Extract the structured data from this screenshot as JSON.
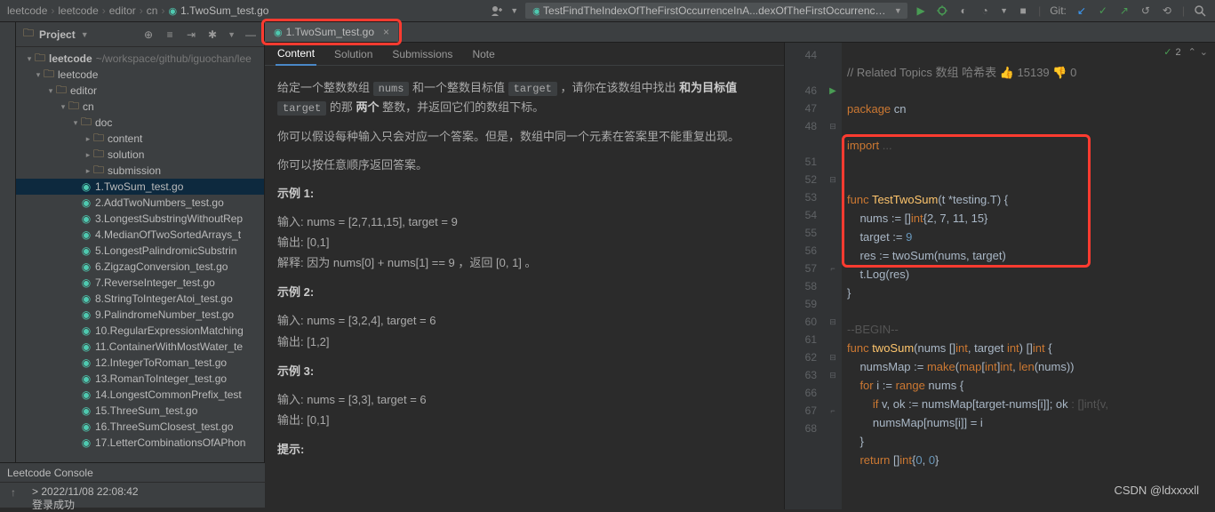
{
  "breadcrumbs": [
    "leetcode",
    "leetcode",
    "editor",
    "cn"
  ],
  "breadcrumb_file": "1.TwoSum_test.go",
  "open_tab": "TestFindTheIndexOfTheFirstOccurrenceInA...dexOfTheFirstOccurrenceInAString_test.go",
  "git_label": "Git:",
  "project": {
    "title": "Project",
    "root": {
      "name": "leetcode",
      "path": "~/workspace/github/iguochan/lee"
    },
    "tree": [
      {
        "indent": 1,
        "kind": "folder",
        "name": "leetcode",
        "chev": "v"
      },
      {
        "indent": 2,
        "kind": "folder",
        "name": "editor",
        "chev": "v"
      },
      {
        "indent": 3,
        "kind": "folder",
        "name": "cn",
        "chev": "v"
      },
      {
        "indent": 4,
        "kind": "folder",
        "name": "doc",
        "chev": "v"
      },
      {
        "indent": 5,
        "kind": "folder",
        "name": "content",
        "chev": ">"
      },
      {
        "indent": 5,
        "kind": "folder",
        "name": "solution",
        "chev": ">"
      },
      {
        "indent": 5,
        "kind": "folder",
        "name": "submission",
        "chev": ">"
      },
      {
        "indent": 4,
        "kind": "go",
        "name": "1.TwoSum_test.go",
        "sel": true
      },
      {
        "indent": 4,
        "kind": "go",
        "name": "2.AddTwoNumbers_test.go"
      },
      {
        "indent": 4,
        "kind": "go",
        "name": "3.LongestSubstringWithoutRep"
      },
      {
        "indent": 4,
        "kind": "go",
        "name": "4.MedianOfTwoSortedArrays_t"
      },
      {
        "indent": 4,
        "kind": "go",
        "name": "5.LongestPalindromicSubstrin"
      },
      {
        "indent": 4,
        "kind": "go",
        "name": "6.ZigzagConversion_test.go"
      },
      {
        "indent": 4,
        "kind": "go",
        "name": "7.ReverseInteger_test.go"
      },
      {
        "indent": 4,
        "kind": "go",
        "name": "8.StringToIntegerAtoi_test.go"
      },
      {
        "indent": 4,
        "kind": "go",
        "name": "9.PalindromeNumber_test.go"
      },
      {
        "indent": 4,
        "kind": "go",
        "name": "10.RegularExpressionMatching"
      },
      {
        "indent": 4,
        "kind": "go",
        "name": "11.ContainerWithMostWater_te"
      },
      {
        "indent": 4,
        "kind": "go",
        "name": "12.IntegerToRoman_test.go"
      },
      {
        "indent": 4,
        "kind": "go",
        "name": "13.RomanToInteger_test.go"
      },
      {
        "indent": 4,
        "kind": "go",
        "name": "14.LongestCommonPrefix_test"
      },
      {
        "indent": 4,
        "kind": "go",
        "name": "15.ThreeSum_test.go"
      },
      {
        "indent": 4,
        "kind": "go",
        "name": "16.ThreeSumClosest_test.go"
      },
      {
        "indent": 4,
        "kind": "go",
        "name": "17.LetterCombinationsOfAPhon"
      }
    ]
  },
  "editor_tab": "1.TwoSum_test.go",
  "content_tabs": [
    "Content",
    "Solution",
    "Submissions",
    "Note"
  ],
  "content": {
    "p1_a": "给定一个整数数组 ",
    "p1_nums": "nums",
    "p1_b": " 和一个整数目标值 ",
    "p1_target": "target",
    "p1_c": " ，请你在该数组中找出 ",
    "p1_bold": "和为目标值",
    "p2_target": "target",
    "p2_a": " 的那 ",
    "p2_bold": "两个",
    "p2_b": " 整数，并返回它们的数组下标。",
    "p3": "你可以假设每种输入只会对应一个答案。但是，数组中同一个元素在答案里不能重复出现。",
    "p4": "你可以按任意顺序返回答案。",
    "ex1": "示例 1:",
    "ex1_in": "输入: nums = [2,7,11,15], target = 9",
    "ex1_out": "输出: [0,1]",
    "ex1_exp": "解释: 因为 nums[0] + nums[1] == 9 ，返回 [0, 1] 。",
    "ex2": "示例 2:",
    "ex2_in": "输入: nums = [3,2,4], target = 6",
    "ex2_out": "输出: [1,2]",
    "ex3": "示例 3:",
    "ex3_in": "输入: nums = [3,3], target = 6",
    "ex3_out": "输出: [0,1]",
    "hint": "提示:"
  },
  "code": {
    "line_start": 44,
    "lines": [
      44,
      "",
      46,
      47,
      48,
      "",
      51,
      52,
      53,
      54,
      55,
      56,
      57,
      58,
      59,
      60,
      61,
      62,
      63,
      66,
      67,
      68
    ],
    "problems": "2",
    "l44": "// Related Topics 数组 哈希表 👍 15139 👎 0",
    "l46_pkg": "package",
    "l46_name": " cn",
    "l48_imp": "import",
    "l48_rest": " ...",
    "l52_func": "func ",
    "l52_name": "TestTwoSum",
    "l52_sig": "(t *testing.T) {",
    "l53": "    nums := []",
    "l53_int": "int",
    "l53_vals": "{2, 7, 11, 15}",
    "l54": "    target := ",
    "l54_v": "9",
    "l55": "    res := twoSum(nums, target)",
    "l56": "    t.Log(res)",
    "l57": "}",
    "l59": "--BEGIN--",
    "l60_func": "func ",
    "l60_name": "twoSum",
    "l60_a": "(nums []",
    "l60_int1": "int",
    "l60_b": ", target ",
    "l60_int2": "int",
    "l60_c": ") []",
    "l60_int3": "int",
    "l60_d": " {",
    "l61_a": "    numsMap := ",
    "l61_make": "make",
    "l61_b": "(",
    "l61_map": "map",
    "l61_c": "[",
    "l61_int1": "int",
    "l61_d": "]",
    "l61_int2": "int",
    "l61_e": ", ",
    "l61_len": "len",
    "l61_f": "(nums))",
    "l62_for": "    for ",
    "l62_a": "i := ",
    "l62_range": "range",
    "l62_b": " nums {",
    "l63_if": "        if ",
    "l63_a": "v, ok := numsMap[target-nums[i]]; ok ",
    "l63_dim": ": []int{v,",
    "l66": "        numsMap[nums[i]] = i",
    "l67": "    }",
    "l68_a": "    return ",
    "l68_b": "[]",
    "l68_int": "int",
    "l68_c": "{",
    "l68_z1": "0",
    "l68_d": ", ",
    "l68_z2": "0",
    "l68_e": "}"
  },
  "console": {
    "title": "Leetcode Console",
    "ts": "> 2022/11/08 22:08:42",
    "msg": "登录成功"
  },
  "watermark": "CSDN @ldxxxxll"
}
